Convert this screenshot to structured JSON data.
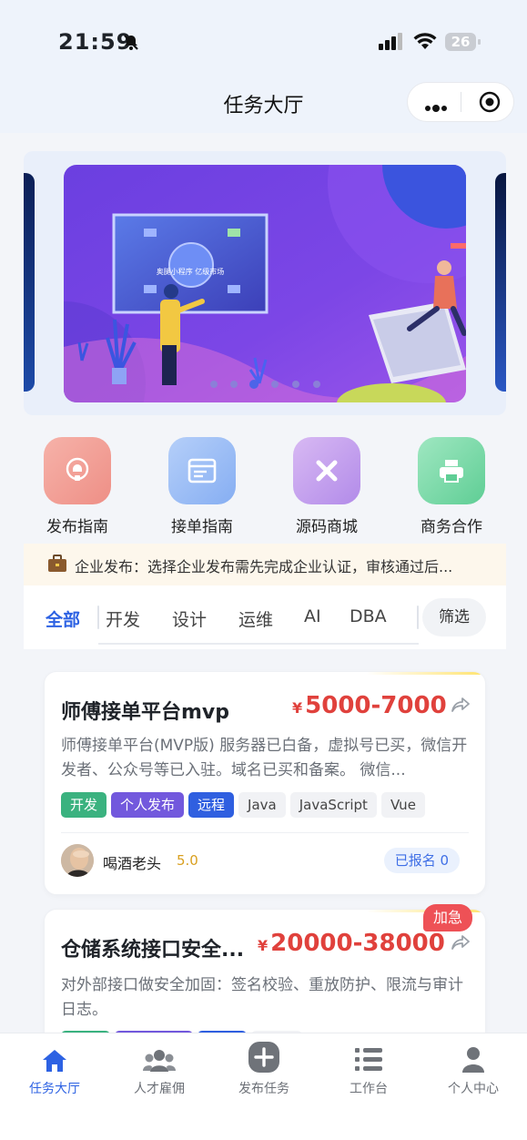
{
  "status_bar": {
    "time": "21:59",
    "battery": "26"
  },
  "nav": {
    "title": "任务大厅"
  },
  "banner": {
    "screen_text": "奥腿小程序  亿级市场",
    "page_count": 6,
    "active_page": 3
  },
  "quick_links": [
    {
      "label": "发布指南",
      "icon": "publish-guide-icon"
    },
    {
      "label": "接单指南",
      "icon": "browser-window-icon"
    },
    {
      "label": "源码商城",
      "icon": "tools-cross-icon"
    },
    {
      "label": "商务合作",
      "icon": "printer-icon"
    }
  ],
  "notice": {
    "text": "企业发布：选择企业发布需先完成企业认证，审核通过后..."
  },
  "tabs": {
    "items": [
      "全部",
      "开发",
      "设计",
      "运维",
      "AI",
      "DBA"
    ],
    "active": "全部",
    "filter": "筛选"
  },
  "tasks": [
    {
      "title": "师傅接单平台mvp",
      "currency": "¥",
      "price": "5000-7000",
      "description": "师傅接单平台(MVP版) 服务器已白备，虚拟号已买，微信开发者、公众号等已入驻。域名已买和备案。 微信...",
      "tags": [
        "开发",
        "个人发布",
        "远程",
        "Java",
        "JavaScript",
        "Vue"
      ],
      "user": {
        "name": "喝酒老头",
        "score": "5.0"
      },
      "signed": "已报名 0"
    },
    {
      "title": "仓储系统接口安全...",
      "currency": "¥",
      "price": "20000-38000",
      "description": "对外部接口做安全加固：签名校验、重放防护、限流与审计日志。",
      "badge": "加急"
    }
  ],
  "bottom_nav": {
    "items": [
      "任务大厅",
      "人才雇佣",
      "发布任务",
      "工作台",
      "个人中心"
    ],
    "active": "任务大厅"
  },
  "colors": {
    "accent": "#2d62e3",
    "price": "#e0413c",
    "urgent": "#ee5156"
  }
}
